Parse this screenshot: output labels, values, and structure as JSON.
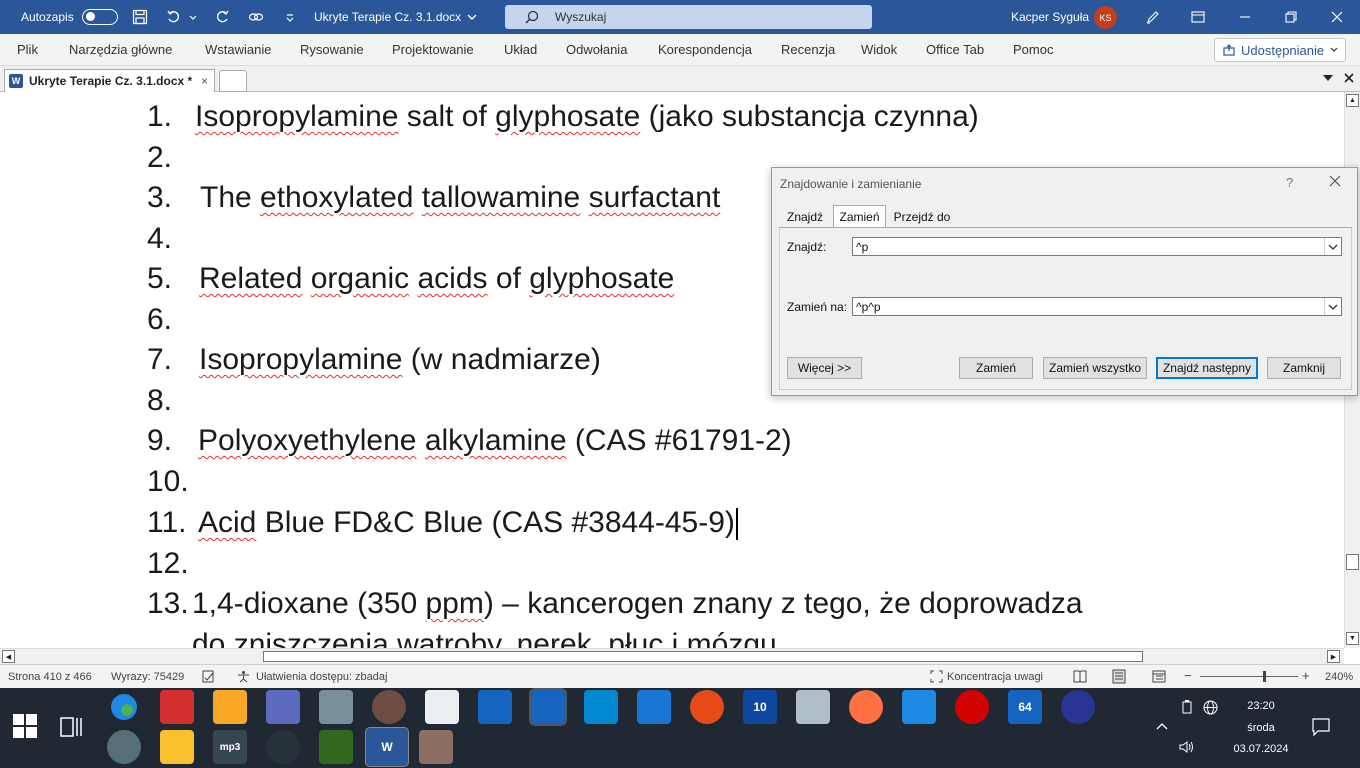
{
  "titlebar": {
    "autosave_label": "Autozapis",
    "doc_title": "Ukryte Terapie Cz. 3.1.docx",
    "search_placeholder": "Wyszukaj",
    "user_name": "Kacper Syguła",
    "user_initials": "KS"
  },
  "ribbon": {
    "tabs": [
      "Plik",
      "Narzędzia główne",
      "Wstawianie",
      "Rysowanie",
      "Projektowanie",
      "Układ",
      "Odwołania",
      "Korespondencja",
      "Recenzja",
      "Widok",
      "Office Tab",
      "Pomoc"
    ],
    "share_label": "Udostępnianie"
  },
  "doc_tab": {
    "name": "Ukryte Terapie Cz. 3.1.docx *",
    "close": "×"
  },
  "document": {
    "lines": [
      {
        "num": "1.",
        "parts": [
          {
            "t": "Isopropylamine",
            "sq": true
          },
          {
            "t": " salt of "
          },
          {
            "t": "glyphosate",
            "sq": true
          },
          {
            "t": " (jako substancja czynna)"
          }
        ]
      },
      {
        "num": "2.",
        "parts": []
      },
      {
        "num": "3.",
        "parts": [
          {
            "t": "The "
          },
          {
            "t": "ethoxylated",
            "sq": true
          },
          {
            "t": " "
          },
          {
            "t": "tallowamine",
            "sq": true
          },
          {
            "t": " "
          },
          {
            "t": "surfactant",
            "sq": true
          }
        ]
      },
      {
        "num": "4.",
        "parts": []
      },
      {
        "num": "5.",
        "parts": [
          {
            "t": "Related",
            "sq": true
          },
          {
            "t": " "
          },
          {
            "t": "organic",
            "sq": true
          },
          {
            "t": " "
          },
          {
            "t": "acids",
            "sq": true
          },
          {
            "t": " of "
          },
          {
            "t": "glyphosate",
            "sq": true
          }
        ]
      },
      {
        "num": "6.",
        "parts": []
      },
      {
        "num": "7.",
        "parts": [
          {
            "t": "Isopropylamine",
            "sq": true
          },
          {
            "t": " (w nadmiarze)"
          }
        ]
      },
      {
        "num": "8.",
        "parts": []
      },
      {
        "num": "9.",
        "parts": [
          {
            "t": "Polyoxyethylene",
            "sq": true
          },
          {
            "t": " "
          },
          {
            "t": "alkylamine",
            "sq": true
          },
          {
            "t": " (CAS #61791-2)"
          }
        ]
      },
      {
        "num": "10.",
        "parts": []
      },
      {
        "num": "11.",
        "parts": [
          {
            "t": "Acid",
            "sq": true
          },
          {
            "t": " Blue FD&C Blue (CAS #3844-45-9)"
          }
        ],
        "caret": true
      },
      {
        "num": "12.",
        "parts": []
      },
      {
        "num": "13.",
        "parts": [
          {
            "t": "1,4-dioxane (350 "
          },
          {
            "t": "ppm",
            "sq": true
          },
          {
            "t": ") – kancerogen znany z tego, że doprowadza"
          }
        ]
      },
      {
        "num": "",
        "parts": [
          {
            "t": "do zniszczenia wątroby, nerek, płuc i mózgu."
          }
        ]
      }
    ]
  },
  "dialog": {
    "title": "Znajdowanie i zamienianie",
    "help": "?",
    "tabs": [
      "Znajdź",
      "Zamień",
      "Przejdź do"
    ],
    "find_label": "Znajdź:",
    "find_value": "^p",
    "replace_label": "Zamień na:",
    "replace_value": "^p^p",
    "more_button": "Więcej >>",
    "replace_button": "Zamień",
    "replace_all_button": "Zamień wszystko",
    "find_next_button": "Znajdź następny",
    "close_button": "Zamknij"
  },
  "status": {
    "page": "Strona 410 z 466",
    "words": "Wyrazy: 75429",
    "accessibility": "Ułatwienia dostępu: zbadaj",
    "focus": "Koncentracja uwagi",
    "zoom": "240%",
    "zoom_minus": "−",
    "zoom_plus": "+"
  },
  "taskbar": {
    "time": "23:20",
    "day": "środa",
    "date": "03.07.2024",
    "app_10": "10",
    "app_64": "64",
    "app_mp3": "mp3"
  },
  "colors": {
    "word_blue": "#2b579a",
    "avatar": "#c43e1c",
    "spell_error": "#e0302d"
  }
}
